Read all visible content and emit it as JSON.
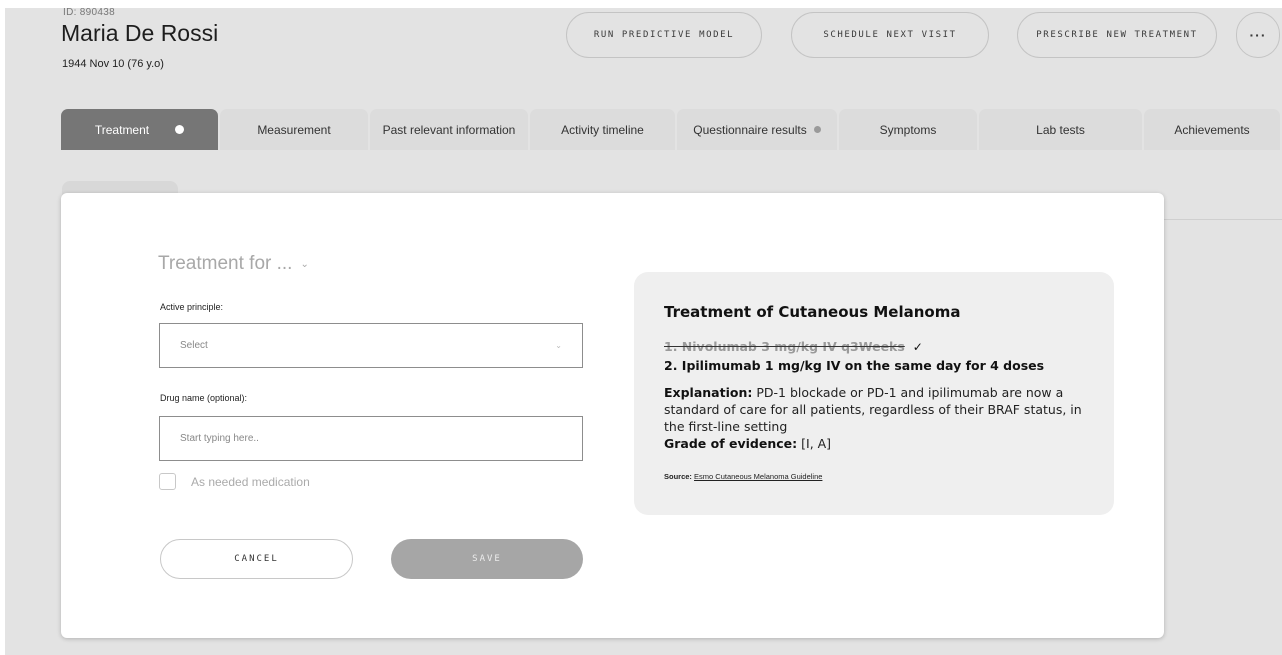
{
  "patient": {
    "id": "ID: 890438",
    "name": "Maria De Rossi",
    "dob": "1944 Nov 10 (76 y.o)"
  },
  "header_actions": {
    "run_model": "RUN PREDICTIVE MODEL",
    "schedule": "SCHEDULE NEXT VISIT",
    "prescribe": "PRESCRIBE NEW TREATMENT",
    "more": "···"
  },
  "tabs": [
    {
      "label": "Treatment",
      "active": true,
      "dot": true
    },
    {
      "label": "Measurement"
    },
    {
      "label": "Past relevant information"
    },
    {
      "label": "Activity timeline"
    },
    {
      "label": "Questionnaire results",
      "dot": true
    },
    {
      "label": "Symptoms"
    },
    {
      "label": "Lab tests"
    },
    {
      "label": "Achievements"
    }
  ],
  "form": {
    "heading": "Treatment for ...",
    "heading_icon": "chevron-down-icon",
    "active_principle_label": "Active principle:",
    "active_principle_value": "Select",
    "drug_name_label": "Drug name (optional):",
    "drug_name_placeholder": "Start typing here..",
    "as_needed_label": "As needed medication",
    "as_needed_checked": false,
    "cancel": "CANCEL",
    "save": "SAVE"
  },
  "recommendation": {
    "title": "Treatment of Cutaneous Melanoma",
    "option1": "1. Nivolumab 3 mg/kg IV q3Weeks",
    "option1_icon": "checkmark-icon",
    "option2": "2. Ipilimumab 1 mg/kg IV on the same day for 4 doses",
    "explanation_label": "Explanation:",
    "explanation_text": "PD-1 blockade or PD-1 and ipilimumab are now a standard of care for all patients, regardless of their BRAF status, in the first-line setting",
    "grade_label": "Grade of evidence:",
    "grade_value": "[I, A]",
    "source_label": "Source:",
    "source_link": "Esmo Cutaneous Melanoma Guideline"
  },
  "colors": {
    "background": "#e3e3e3",
    "active_tab": "#767676",
    "save_button": "#a6a6a6",
    "panel": "#efefef"
  }
}
